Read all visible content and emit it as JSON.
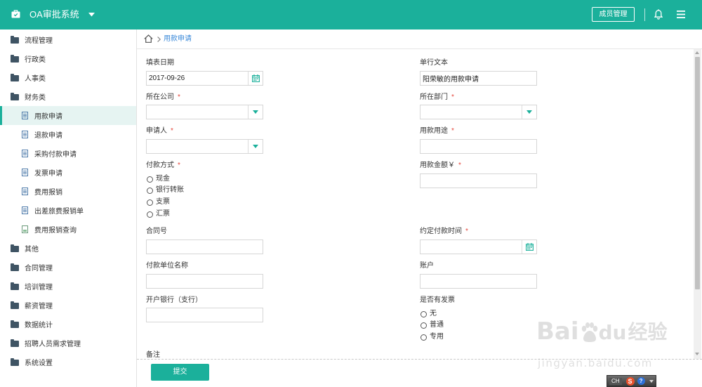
{
  "colors": {
    "accent": "#1bb09b",
    "link": "#3b8ad9",
    "required": "#e5463b",
    "active_row": "#e6f4f2"
  },
  "header": {
    "title": "OA审批系统",
    "member_button": "成员管理",
    "icons": [
      "briefcase-icon",
      "chevron-down-icon",
      "bell-icon",
      "hamburger-menu-icon"
    ]
  },
  "sidebar": {
    "groups": [
      {
        "label": "流程管理",
        "icon": "folder-icon"
      },
      {
        "label": "行政类",
        "icon": "folder-icon"
      },
      {
        "label": "人事类",
        "icon": "folder-icon"
      },
      {
        "label": "财务类",
        "icon": "folder-icon",
        "expanded": true,
        "children": [
          {
            "label": "用款申请",
            "icon": "document-icon",
            "active": true
          },
          {
            "label": "退款申请",
            "icon": "document-icon"
          },
          {
            "label": "采购付款申请",
            "icon": "document-icon"
          },
          {
            "label": "发票申请",
            "icon": "document-icon"
          },
          {
            "label": "费用报销",
            "icon": "document-icon"
          },
          {
            "label": "出差旅费报销单",
            "icon": "document-icon"
          },
          {
            "label": "费用报销查询",
            "icon": "spreadsheet-icon"
          }
        ]
      },
      {
        "label": "其他",
        "icon": "folder-icon"
      },
      {
        "label": "合同管理",
        "icon": "folder-icon"
      },
      {
        "label": "培训管理",
        "icon": "folder-icon"
      },
      {
        "label": "薪资管理",
        "icon": "folder-icon"
      },
      {
        "label": "数据统计",
        "icon": "folder-icon"
      },
      {
        "label": "招聘人员需求管理",
        "icon": "folder-icon"
      },
      {
        "label": "系统设置",
        "icon": "folder-icon"
      }
    ]
  },
  "breadcrumb": {
    "home_icon": "home-icon",
    "current": "用款申请"
  },
  "form": {
    "required_mark": "*",
    "fill_date": {
      "label": "填表日期",
      "value": "2017-09-26"
    },
    "single_text": {
      "label": "单行文本",
      "value": "阳荣敏的用款申请"
    },
    "company": {
      "label": "所在公司",
      "required": true,
      "value": ""
    },
    "department": {
      "label": "所在部门",
      "required": true,
      "value": ""
    },
    "applicant": {
      "label": "申请人",
      "required": true,
      "value": ""
    },
    "purpose": {
      "label": "用款用途",
      "required": true,
      "value": ""
    },
    "payment_method": {
      "label": "付款方式",
      "required": true,
      "options": [
        "现金",
        "银行转账",
        "支票",
        "汇票"
      ],
      "selected": null
    },
    "amount": {
      "label": "用款金额￥",
      "required": true,
      "value": ""
    },
    "contract_no": {
      "label": "合同号",
      "value": ""
    },
    "payment_date": {
      "label": "约定付款时间",
      "required": true,
      "value": ""
    },
    "payee": {
      "label": "付款单位名称",
      "value": ""
    },
    "account": {
      "label": "账户",
      "value": ""
    },
    "bank": {
      "label": "开户银行（支行）",
      "value": ""
    },
    "invoice": {
      "label": "是否有发票",
      "options": [
        "无",
        "普通",
        "专用"
      ],
      "selected": null
    },
    "remark": {
      "label": "备注"
    }
  },
  "actions": {
    "submit": "提交"
  },
  "ime_toolbar": {
    "language": "CH",
    "logo_letter": "S",
    "help_glyph": "?"
  },
  "watermark": {
    "brand_left": "Bai",
    "brand_right": "du",
    "brand_cn": "经验",
    "url": "jingyan.baidu.com"
  }
}
